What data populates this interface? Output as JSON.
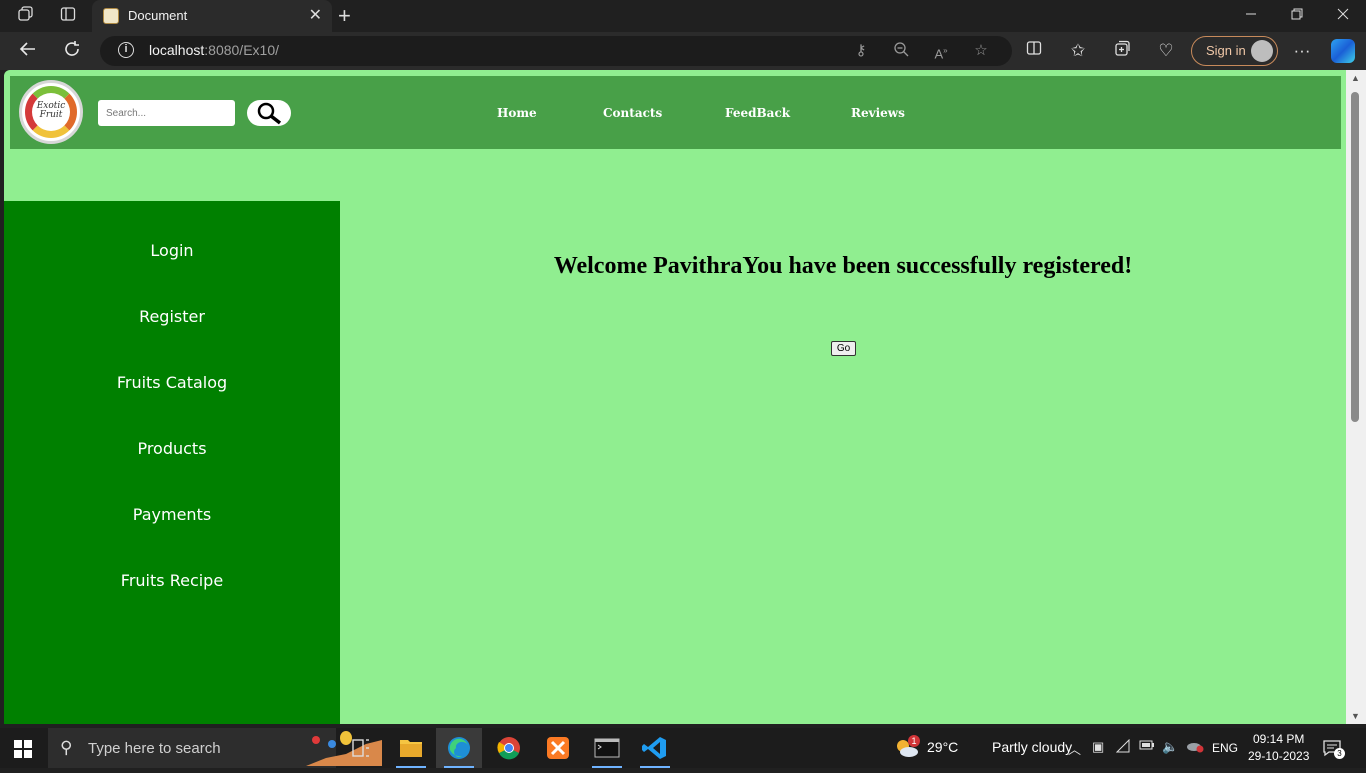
{
  "browser": {
    "tab_title": "Document",
    "close_glyph": "✕",
    "new_tab_glyph": "+",
    "url_host": "localhost",
    "url_rest": ":8080/Ex10/",
    "sign_in_label": "Sign in",
    "more_glyph": "···"
  },
  "site": {
    "logo_line1": "Exotic",
    "logo_line2": "Fruit",
    "search_placeholder": "Search...",
    "nav": [
      "Home",
      "Contacts",
      "FeedBack",
      "Reviews"
    ],
    "sidebar": [
      "Login",
      "Register",
      "Fruits Catalog",
      "Products",
      "Payments",
      "Fruits Recipe"
    ],
    "welcome_message": "Welcome PavithraYou have been successfully registered!",
    "go_label": "Go"
  },
  "taskbar": {
    "search_placeholder": "Type here to search",
    "weather_temp": "29°C",
    "weather_desc": "Partly cloudy",
    "weather_badge": "1",
    "language": "ENG",
    "time": "09:14 PM",
    "date": "29-10-2023",
    "notification_count": "3"
  },
  "colors": {
    "header_green": "#48a048",
    "sidebar_green": "#008000",
    "page_green": "#90ee90"
  }
}
